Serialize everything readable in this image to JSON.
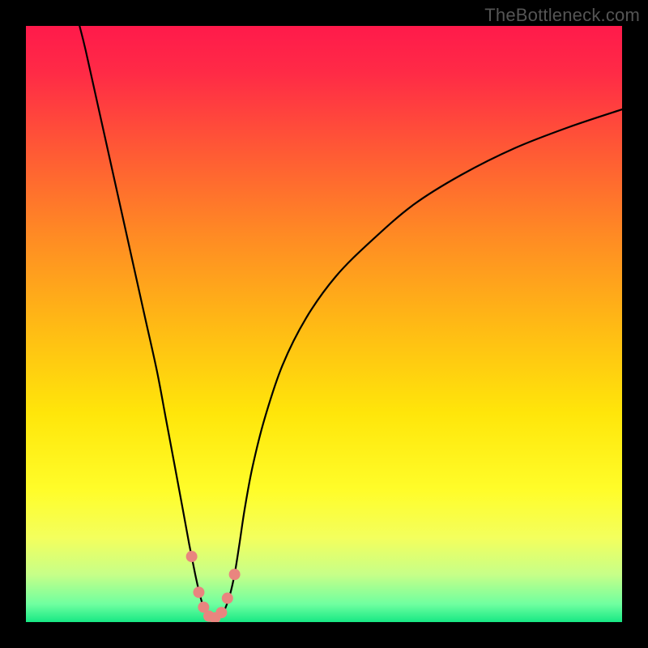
{
  "watermark": "TheBottleneck.com",
  "gradient": {
    "stops": [
      {
        "offset": 0.0,
        "color": "#ff1a4b"
      },
      {
        "offset": 0.08,
        "color": "#ff2b46"
      },
      {
        "offset": 0.2,
        "color": "#ff5636"
      },
      {
        "offset": 0.35,
        "color": "#ff8a24"
      },
      {
        "offset": 0.5,
        "color": "#ffb915"
      },
      {
        "offset": 0.65,
        "color": "#ffe60a"
      },
      {
        "offset": 0.78,
        "color": "#fffd2a"
      },
      {
        "offset": 0.86,
        "color": "#f3ff5e"
      },
      {
        "offset": 0.92,
        "color": "#c7ff88"
      },
      {
        "offset": 0.97,
        "color": "#6fffa0"
      },
      {
        "offset": 1.0,
        "color": "#17e884"
      }
    ]
  },
  "chart_data": {
    "type": "line",
    "title": "",
    "xlabel": "",
    "ylabel": "",
    "xlim": [
      0,
      100
    ],
    "ylim": [
      0,
      100
    ],
    "series": [
      {
        "name": "bottleneck-curve",
        "x": [
          9,
          10,
          12,
          14,
          16,
          18,
          20,
          22,
          23.5,
          25,
          26.3,
          27.4,
          28.4,
          29.2,
          29.9,
          30.6,
          31.3,
          32.0,
          32.7,
          33.4,
          34.2,
          35.0,
          35.8,
          36.7,
          38.0,
          40.0,
          43.0,
          47.0,
          52.0,
          58.0,
          65.0,
          73.0,
          82.0,
          91.0,
          100.0
        ],
        "y": [
          100,
          96,
          87,
          78,
          69,
          60,
          51,
          42,
          34,
          26,
          19,
          13,
          8,
          4.5,
          2.2,
          1.0,
          0.5,
          0.5,
          1.0,
          2.2,
          4.5,
          8,
          13,
          19,
          26,
          34,
          43,
          51,
          58,
          64,
          70,
          75,
          79.5,
          83,
          86
        ]
      }
    ],
    "markers": {
      "name": "highlighted-points",
      "color": "#e9857f",
      "points": [
        {
          "x": 27.8,
          "y": 11.0
        },
        {
          "x": 29.0,
          "y": 5.0
        },
        {
          "x": 29.8,
          "y": 2.5
        },
        {
          "x": 30.7,
          "y": 1.0
        },
        {
          "x": 31.7,
          "y": 0.7
        },
        {
          "x": 32.8,
          "y": 1.6
        },
        {
          "x": 33.8,
          "y": 4.0
        },
        {
          "x": 35.0,
          "y": 8.0
        }
      ]
    }
  }
}
